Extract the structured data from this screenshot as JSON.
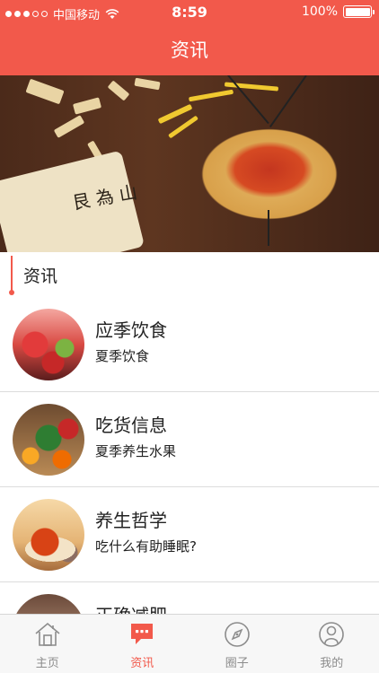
{
  "status_bar": {
    "carrier": "中国移动",
    "time": "8:59",
    "battery": "100%",
    "signal_bars": 3
  },
  "nav": {
    "title": "资讯"
  },
  "banner": {
    "image": "traditional-chinese-medicine-herbs",
    "scroll_text": "艮 為 山"
  },
  "section": {
    "title": "资讯"
  },
  "articles": [
    {
      "title": "应季饮食",
      "subtitle": "夏季饮食",
      "thumb": "watermelon-fruits"
    },
    {
      "title": "吃货信息",
      "subtitle": "夏季养生水果",
      "thumb": "fruit-basket"
    },
    {
      "title": "养生哲学",
      "subtitle": "吃什么有助睡眠?",
      "thumb": "herbal-tea"
    },
    {
      "title": "正确减肥",
      "subtitle": "",
      "thumb": "partial"
    }
  ],
  "tabbar": {
    "items": [
      {
        "label": "主页",
        "icon": "home-icon",
        "active": false
      },
      {
        "label": "资讯",
        "icon": "news-chat-icon",
        "active": true
      },
      {
        "label": "圈子",
        "icon": "compass-icon",
        "active": false
      },
      {
        "label": "我的",
        "icon": "profile-icon",
        "active": false
      }
    ]
  },
  "colors": {
    "accent": "#f2594b",
    "tab_inactive": "#8c8c8c",
    "divider": "#dcdcdc"
  }
}
